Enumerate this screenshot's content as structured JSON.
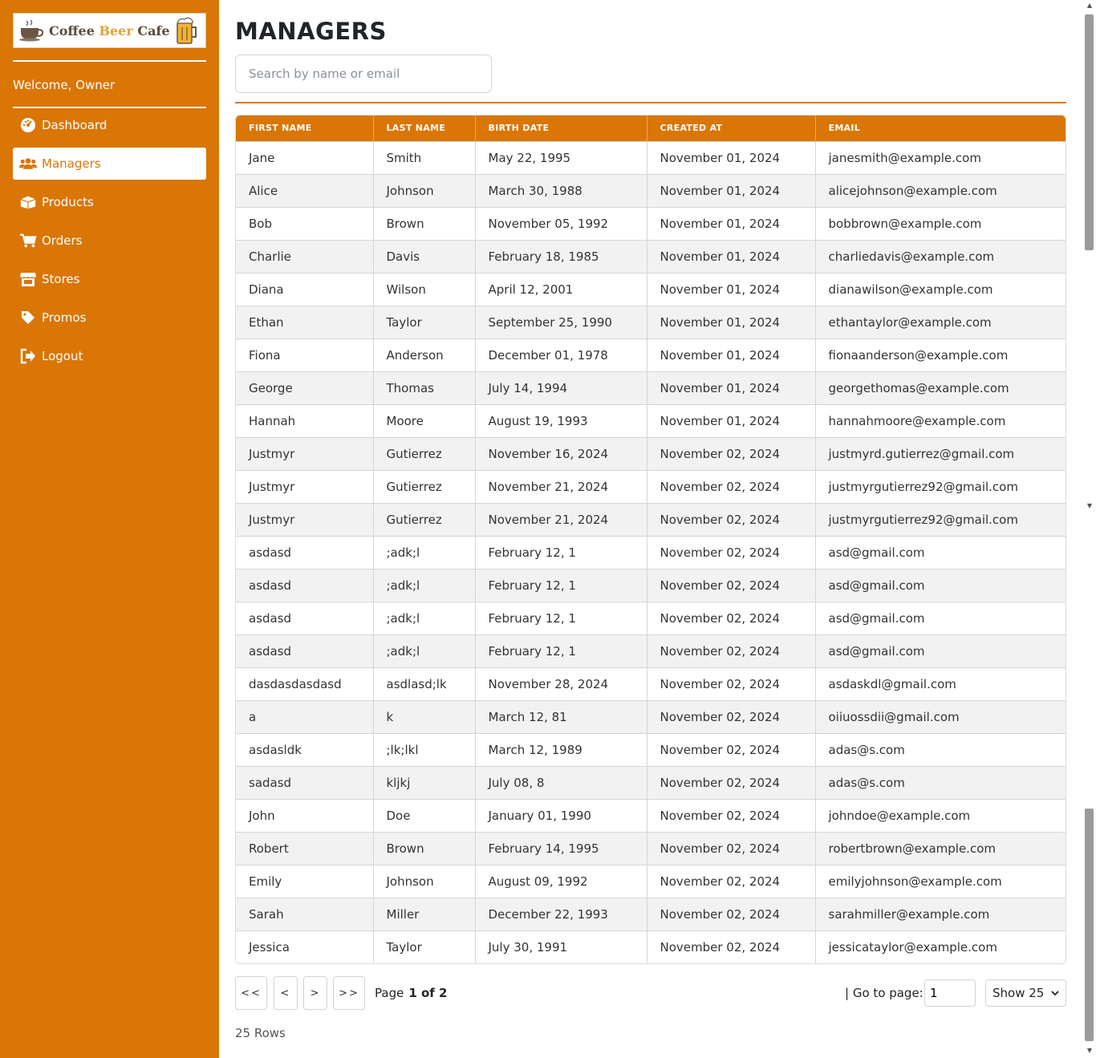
{
  "brand": {
    "part1": "Coffee ",
    "part2": "Beer ",
    "part3": "Cafe"
  },
  "welcome": "Welcome, Owner",
  "nav": [
    {
      "label": "Dashboard",
      "icon": "dashboard-icon"
    },
    {
      "label": "Managers",
      "icon": "users-icon",
      "active": true
    },
    {
      "label": "Products",
      "icon": "box-icon"
    },
    {
      "label": "Orders",
      "icon": "cart-icon"
    },
    {
      "label": "Stores",
      "icon": "store-icon"
    },
    {
      "label": "Promos",
      "icon": "tag-icon"
    },
    {
      "label": "Logout",
      "icon": "logout-icon"
    }
  ],
  "page": {
    "title": "MANAGERS",
    "search_placeholder": "Search by name or email"
  },
  "table": {
    "columns": [
      "FIRST NAME",
      "LAST NAME",
      "BIRTH DATE",
      "CREATED AT",
      "EMAIL"
    ],
    "rows": [
      [
        "Jane",
        "Smith",
        "May 22, 1995",
        "November 01, 2024",
        "janesmith@example.com"
      ],
      [
        "Alice",
        "Johnson",
        "March 30, 1988",
        "November 01, 2024",
        "alicejohnson@example.com"
      ],
      [
        "Bob",
        "Brown",
        "November 05, 1992",
        "November 01, 2024",
        "bobbrown@example.com"
      ],
      [
        "Charlie",
        "Davis",
        "February 18, 1985",
        "November 01, 2024",
        "charliedavis@example.com"
      ],
      [
        "Diana",
        "Wilson",
        "April 12, 2001",
        "November 01, 2024",
        "dianawilson@example.com"
      ],
      [
        "Ethan",
        "Taylor",
        "September 25, 1990",
        "November 01, 2024",
        "ethantaylor@example.com"
      ],
      [
        "Fiona",
        "Anderson",
        "December 01, 1978",
        "November 01, 2024",
        "fionaanderson@example.com"
      ],
      [
        "George",
        "Thomas",
        "July 14, 1994",
        "November 01, 2024",
        "georgethomas@example.com"
      ],
      [
        "Hannah",
        "Moore",
        "August 19, 1993",
        "November 01, 2024",
        "hannahmoore@example.com"
      ],
      [
        "Justmyr",
        "Gutierrez",
        "November 16, 2024",
        "November 02, 2024",
        "justmyrd.gutierrez@gmail.com"
      ],
      [
        "Justmyr",
        "Gutierrez",
        "November 21, 2024",
        "November 02, 2024",
        "justmyrgutierrez92@gmail.com"
      ],
      [
        "Justmyr",
        "Gutierrez",
        "November 21, 2024",
        "November 02, 2024",
        "justmyrgutierrez92@gmail.com"
      ],
      [
        "asdasd",
        ";adk;l",
        "February 12, 1",
        "November 02, 2024",
        "asd@gmail.com"
      ],
      [
        "asdasd",
        ";adk;l",
        "February 12, 1",
        "November 02, 2024",
        "asd@gmail.com"
      ],
      [
        "asdasd",
        ";adk;l",
        "February 12, 1",
        "November 02, 2024",
        "asd@gmail.com"
      ],
      [
        "asdasd",
        ";adk;l",
        "February 12, 1",
        "November 02, 2024",
        "asd@gmail.com"
      ],
      [
        "dasdasdasdasd",
        "asdlasd;lk",
        "November 28, 2024",
        "November 02, 2024",
        "asdaskdl@gmail.com"
      ],
      [
        "a",
        "k",
        "March 12, 81",
        "November 02, 2024",
        "oiiuossdii@gmail.com"
      ],
      [
        "asdasldk",
        ";lk;lkl",
        "March 12, 1989",
        "November 02, 2024",
        "adas@s.com"
      ],
      [
        "sadasd",
        "kljkj",
        "July 08, 8",
        "November 02, 2024",
        "adas@s.com"
      ],
      [
        "John",
        "Doe",
        "January 01, 1990",
        "November 02, 2024",
        "johndoe@example.com"
      ],
      [
        "Robert",
        "Brown",
        "February 14, 1995",
        "November 02, 2024",
        "robertbrown@example.com"
      ],
      [
        "Emily",
        "Johnson",
        "August 09, 1992",
        "November 02, 2024",
        "emilyjohnson@example.com"
      ],
      [
        "Sarah",
        "Miller",
        "December 22, 1993",
        "November 02, 2024",
        "sarahmiller@example.com"
      ],
      [
        "Jessica",
        "Taylor",
        "July 30, 1991",
        "November 02, 2024",
        "jessicataylor@example.com"
      ]
    ]
  },
  "pagination": {
    "first": "<<",
    "prev": "<",
    "next": ">",
    "last": ">>",
    "page_label": "Page",
    "page_value": "1 of 2",
    "goto_label": "| Go to page:",
    "goto_value": "1",
    "show_value": "Show 25",
    "rows_count": "25 Rows"
  },
  "colors": {
    "accent": "#d97605",
    "stripe": "#f2f2f2"
  }
}
